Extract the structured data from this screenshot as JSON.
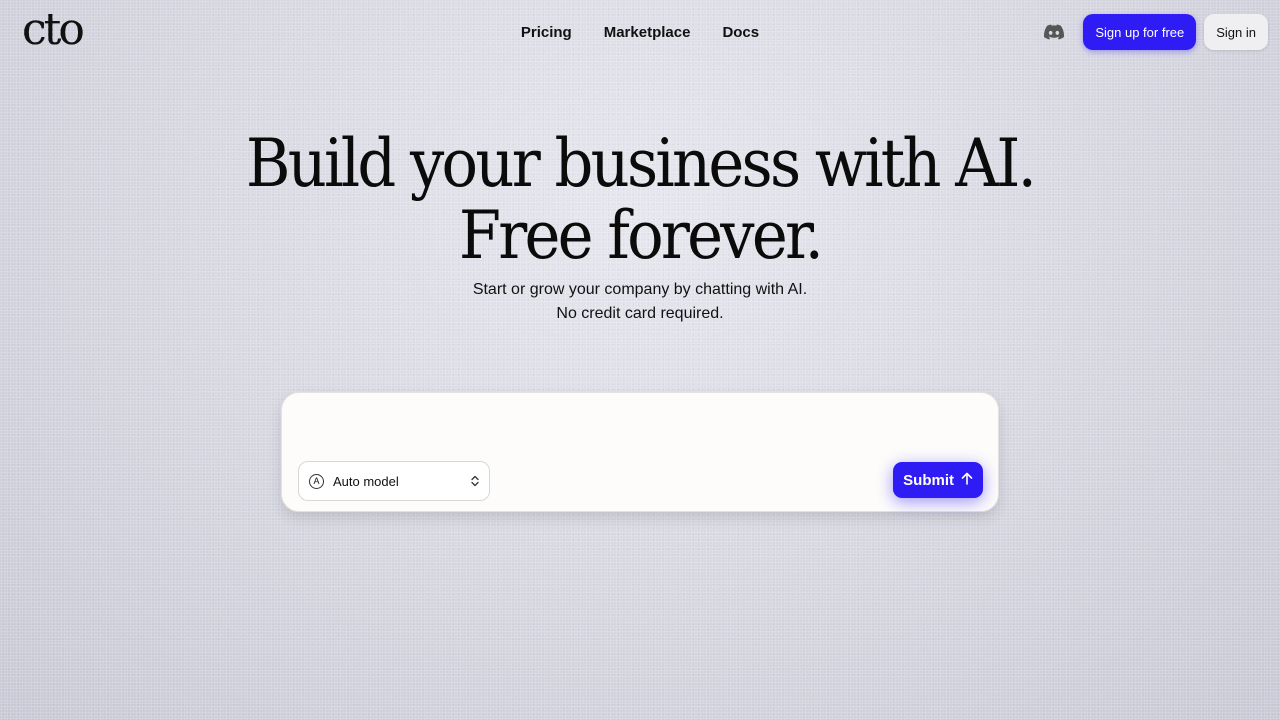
{
  "brand": {
    "logo_text": "cto"
  },
  "nav": {
    "items": [
      {
        "label": "Pricing"
      },
      {
        "label": "Marketplace"
      },
      {
        "label": "Docs"
      }
    ]
  },
  "header_actions": {
    "discord_icon": "discord-icon",
    "signup_label": "Sign up for free",
    "signin_label": "Sign in"
  },
  "hero": {
    "title_line1": "Build your business with AI.",
    "title_line2": "Free forever.",
    "subtitle_line1": "Start or grow your company by chatting with AI.",
    "subtitle_line2": "No credit card required."
  },
  "composer": {
    "input_value": "",
    "model_select_value": "Auto model",
    "model_icon": "auto-model-icon",
    "submit_label": "Submit",
    "submit_icon": "arrow-up-icon"
  },
  "colors": {
    "accent": "#2f1cf5",
    "background": "#dcdce5"
  }
}
